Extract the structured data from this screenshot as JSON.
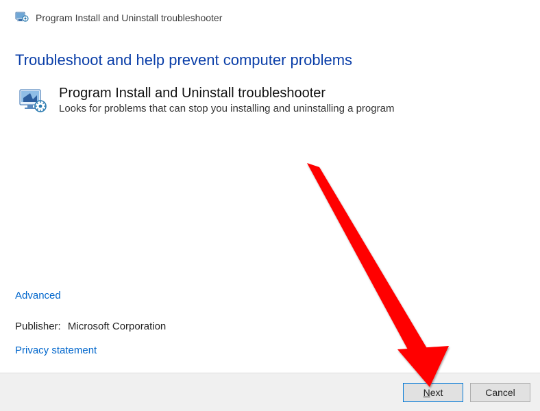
{
  "header": {
    "title": "Program Install and Uninstall troubleshooter"
  },
  "page": {
    "heading": "Troubleshoot and help prevent computer problems",
    "item_title": "Program Install and Uninstall troubleshooter",
    "item_desc": "Looks for problems that can stop you installing and uninstalling a program"
  },
  "links": {
    "advanced": "Advanced",
    "publisher_label": "Publisher:",
    "publisher_value": "Microsoft Corporation",
    "privacy": "Privacy statement"
  },
  "buttons": {
    "next_prefix": "N",
    "next_rest": "ext",
    "cancel": "Cancel"
  }
}
